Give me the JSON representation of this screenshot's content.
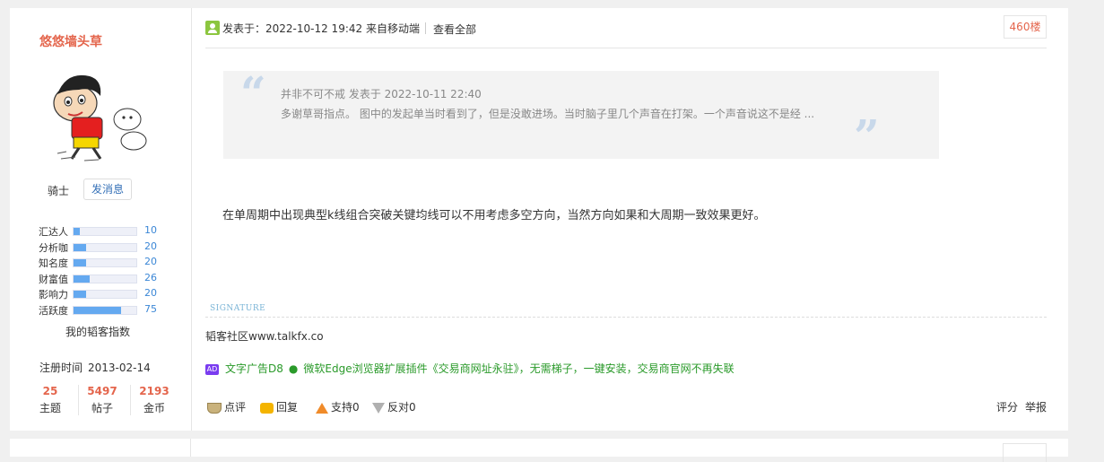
{
  "author": {
    "username": "悠悠墙头草",
    "rank": "骑士",
    "message_button": "发消息",
    "stats": [
      {
        "label": "汇达人",
        "value": "10",
        "fraction": 0.1
      },
      {
        "label": "分析咖",
        "value": "20",
        "fraction": 0.2
      },
      {
        "label": "知名度",
        "value": "20",
        "fraction": 0.2
      },
      {
        "label": "财富值",
        "value": "26",
        "fraction": 0.26
      },
      {
        "label": "影响力",
        "value": "20",
        "fraction": 0.2
      },
      {
        "label": "活跃度",
        "value": "75",
        "fraction": 0.75
      }
    ],
    "index_link": "我的韬客指数",
    "register_label": "注册时间",
    "register_date": "2013-02-14",
    "counts": [
      {
        "num": "25",
        "label": "主题"
      },
      {
        "num": "5497",
        "label": "帖子"
      },
      {
        "num": "2193",
        "label": "金币"
      }
    ]
  },
  "post": {
    "meta": "发表于：2022-10-12 19:42  来自移动端",
    "view_all": "查看全部",
    "floor": "460楼",
    "quote_author_line": "并非不可不戒 发表于 2022-10-11 22:40",
    "quote_text": "多谢草哥指点。 图中的发起单当时看到了，但是没敢进场。当时脑子里几个声音在打架。一个声音说这不是经 ...",
    "content": "在单周期中出现典型k线组合突破关键均线可以不用考虑多空方向，当然方向如果和大周期一致效果更好。",
    "signature_label": "SIGNATURE",
    "signature": "韬客社区www.talkfx.co",
    "ad": {
      "badge": "AD",
      "title": "文字广告D8",
      "dot": "●",
      "text": "微软Edge浏览器扩展插件《交易商网址永驻》，无需梯子，一键安装，交易商官网不再失联"
    },
    "actions": {
      "comment": "点评",
      "reply": "回复",
      "support": "支持0",
      "oppose": "反对0",
      "rate": "评分",
      "report": "举报"
    }
  }
}
